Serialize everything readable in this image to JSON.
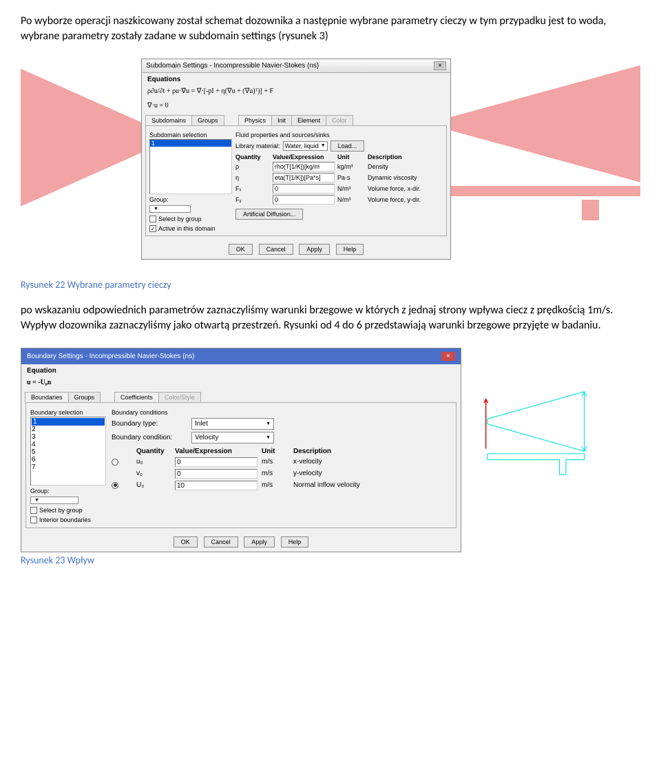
{
  "para1": "Po wyborze operacji naszkicowany został schemat dozownika a następnie wybrane parametry cieczy w tym przypadku jest to woda, wybrane parametry zostały zadane w  subdomain settings (rysunek 3)",
  "dialog1": {
    "title": "Subdomain Settings - Incompressible Navier-Stokes (ns)",
    "close": "×",
    "equations_label": "Equations",
    "eq1": "ρ∂u/∂t + ρu·∇u = ∇·[-pI + η(∇u + (∇u)ᵀ)] + F",
    "eq2": "∇·u = 0",
    "tabs_left": [
      "Subdomains",
      "Groups"
    ],
    "tabs_right": [
      "Physics",
      "Init",
      "Element",
      "Color"
    ],
    "subdomain_sel_label": "Subdomain selection",
    "list_item": "1",
    "group_label": "Group:",
    "chk1": "Select by group",
    "chk2": "Active in this domain",
    "chk2_checked": "✓",
    "right_heading": "Fluid properties and sources/sinks",
    "lib_label": "Library material:",
    "lib_value": "Water, liquid",
    "load_btn": "Load...",
    "headers": {
      "q": "Quantity",
      "v": "Value/Expression",
      "u": "Unit",
      "d": "Description"
    },
    "rows": [
      {
        "q": "ρ",
        "v": "rho(T[1/K])[kg/m",
        "u": "kg/m³",
        "d": "Density"
      },
      {
        "q": "η",
        "v": "eta(T[1/K])[Pa*s]",
        "u": "Pa·s",
        "d": "Dynamic viscosity"
      },
      {
        "q": "Fₓ",
        "v": "0",
        "u": "N/m³",
        "d": "Volume force, x-dir."
      },
      {
        "q": "Fᵧ",
        "v": "0",
        "u": "N/m³",
        "d": "Volume force, y-dir."
      }
    ],
    "art_diff": "Artificial Diffusion...",
    "buttons": [
      "OK",
      "Cancel",
      "Apply",
      "Help"
    ]
  },
  "caption1": "Rysunek 22 Wybrane parametry cieczy",
  "para2": "po wskazaniu odpowiednich parametrów zaznaczyliśmy warunki brzegowe w których z jednaj strony wpływa ciecz z prędkością 1m/s. Wypływ dozownika zaznaczyliśmy jako otwartą przestrzeń. Rysunki od 4 do 6 przedstawiają warunki brzegowe przyjęte w badaniu.",
  "dialog2": {
    "title": "Boundary Settings - Incompressible Navier-Stokes (ns)",
    "close": "×",
    "equation_label": "Equation",
    "eq": "u = -U₀n",
    "tabs_left": [
      "Boundaries",
      "Groups"
    ],
    "tabs_right": [
      "Coefficients",
      "Color/Style"
    ],
    "boundary_sel_label": "Boundary selection",
    "list_items": [
      "1",
      "2",
      "3",
      "4",
      "5",
      "6",
      "7"
    ],
    "group_label": "Group:",
    "chk1": "Select by group",
    "chk2": "Interior boundaries",
    "cond_heading": "Boundary conditions",
    "btype_label": "Boundary type:",
    "btype_value": "Inlet",
    "bcond_label": "Boundary condition:",
    "bcond_value": "Velocity",
    "headers": {
      "q": "Quantity",
      "v": "Value/Expression",
      "u": "Unit",
      "d": "Description"
    },
    "rows": [
      {
        "r": "off",
        "q": "u₀",
        "v": "0",
        "u": "m/s",
        "d": "x-velocity"
      },
      {
        "r": "",
        "q": "v₀",
        "v": "0",
        "u": "m/s",
        "d": "y-velocity"
      },
      {
        "r": "on",
        "q": "U₀",
        "v": "10",
        "u": "m/s",
        "d": "Normal inflow velocity"
      }
    ],
    "buttons": [
      "OK",
      "Cancel",
      "Apply",
      "Help"
    ]
  },
  "caption2": "Rysunek 23 Wpływ"
}
